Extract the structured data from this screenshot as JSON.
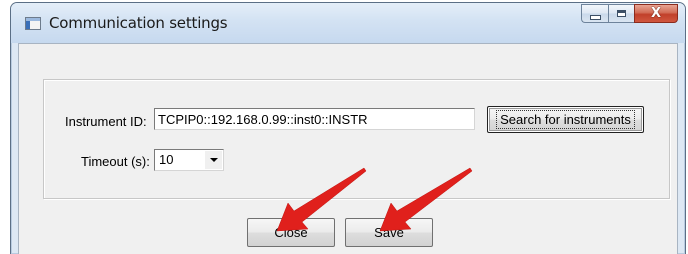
{
  "window": {
    "title": "Communication settings",
    "icon": "application-window-icon",
    "caption": {
      "minimize_icon": "minimize-icon",
      "maximize_icon": "maximize-icon",
      "close_glyph": "X"
    }
  },
  "form": {
    "instrument_id_label": "Instrument ID:",
    "instrument_id_value": "TCPIP0::192.168.0.99::inst0::INSTR",
    "search_button_label": "Search for instruments",
    "timeout_label": "Timeout (s):",
    "timeout_value": "10"
  },
  "footer": {
    "close_label": "Close",
    "save_label": "Save"
  },
  "annotations": {
    "arrow_color": "#e0201c",
    "arrow_icon": "red-arrow-icon"
  },
  "colors": {
    "title_bar": "#d3e2f3",
    "client_background": "#f0f0f0",
    "close_button": "#c1402a"
  }
}
